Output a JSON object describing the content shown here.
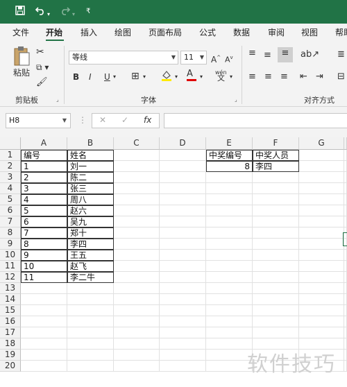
{
  "qat": {
    "save_icon": "save-icon",
    "undo_icon": "undo-icon",
    "redo_icon": "redo-icon",
    "customize_icon": "customize-icon"
  },
  "tabs": [
    "文件",
    "开始",
    "插入",
    "绘图",
    "页面布局",
    "公式",
    "数据",
    "审阅",
    "视图",
    "帮助"
  ],
  "active_tab": "开始",
  "ribbon": {
    "clipboard": {
      "paste_label": "粘贴",
      "group_label": "剪贴板"
    },
    "font": {
      "font_name": "等线",
      "font_size": "11",
      "bold": "B",
      "italic": "I",
      "underline": "U",
      "font_color_glyph": "A",
      "phonetic": "wén",
      "group_label": "字体"
    },
    "alignment": {
      "group_label": "对齐方式"
    }
  },
  "formula_bar": {
    "name_box": "H8",
    "cancel": "✕",
    "enter": "✓",
    "fx": "fx",
    "formula": ""
  },
  "columns": [
    "A",
    "B",
    "C",
    "D",
    "E",
    "F",
    "G"
  ],
  "rows": [
    "1",
    "2",
    "3",
    "4",
    "5",
    "6",
    "7",
    "8",
    "9",
    "10",
    "11",
    "12",
    "13",
    "14",
    "15",
    "16",
    "17",
    "18",
    "19",
    "20"
  ],
  "table1": {
    "headers": [
      "编号",
      "姓名"
    ],
    "rows": [
      [
        "1",
        "刘一"
      ],
      [
        "2",
        "陈二"
      ],
      [
        "3",
        "张三"
      ],
      [
        "4",
        "周八"
      ],
      [
        "5",
        "赵六"
      ],
      [
        "6",
        "吴九"
      ],
      [
        "7",
        "郑十"
      ],
      [
        "8",
        "李四"
      ],
      [
        "9",
        "王五"
      ],
      [
        "10",
        "赵飞"
      ],
      [
        "11",
        "李二牛"
      ]
    ]
  },
  "table2": {
    "headers": [
      "中奖编号",
      "中奖人员"
    ],
    "row": [
      "8",
      "李四"
    ]
  },
  "watermark": "软件技巧",
  "colors": {
    "brand": "#217346"
  }
}
